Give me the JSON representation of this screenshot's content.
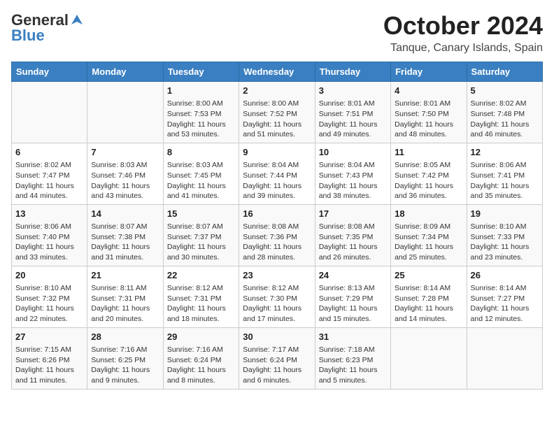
{
  "header": {
    "logo_general": "General",
    "logo_blue": "Blue",
    "month": "October 2024",
    "location": "Tanque, Canary Islands, Spain"
  },
  "days_of_week": [
    "Sunday",
    "Monday",
    "Tuesday",
    "Wednesday",
    "Thursday",
    "Friday",
    "Saturday"
  ],
  "weeks": [
    [
      {
        "day": "",
        "text": ""
      },
      {
        "day": "",
        "text": ""
      },
      {
        "day": "1",
        "text": "Sunrise: 8:00 AM\nSunset: 7:53 PM\nDaylight: 11 hours and 53 minutes."
      },
      {
        "day": "2",
        "text": "Sunrise: 8:00 AM\nSunset: 7:52 PM\nDaylight: 11 hours and 51 minutes."
      },
      {
        "day": "3",
        "text": "Sunrise: 8:01 AM\nSunset: 7:51 PM\nDaylight: 11 hours and 49 minutes."
      },
      {
        "day": "4",
        "text": "Sunrise: 8:01 AM\nSunset: 7:50 PM\nDaylight: 11 hours and 48 minutes."
      },
      {
        "day": "5",
        "text": "Sunrise: 8:02 AM\nSunset: 7:48 PM\nDaylight: 11 hours and 46 minutes."
      }
    ],
    [
      {
        "day": "6",
        "text": "Sunrise: 8:02 AM\nSunset: 7:47 PM\nDaylight: 11 hours and 44 minutes."
      },
      {
        "day": "7",
        "text": "Sunrise: 8:03 AM\nSunset: 7:46 PM\nDaylight: 11 hours and 43 minutes."
      },
      {
        "day": "8",
        "text": "Sunrise: 8:03 AM\nSunset: 7:45 PM\nDaylight: 11 hours and 41 minutes."
      },
      {
        "day": "9",
        "text": "Sunrise: 8:04 AM\nSunset: 7:44 PM\nDaylight: 11 hours and 39 minutes."
      },
      {
        "day": "10",
        "text": "Sunrise: 8:04 AM\nSunset: 7:43 PM\nDaylight: 11 hours and 38 minutes."
      },
      {
        "day": "11",
        "text": "Sunrise: 8:05 AM\nSunset: 7:42 PM\nDaylight: 11 hours and 36 minutes."
      },
      {
        "day": "12",
        "text": "Sunrise: 8:06 AM\nSunset: 7:41 PM\nDaylight: 11 hours and 35 minutes."
      }
    ],
    [
      {
        "day": "13",
        "text": "Sunrise: 8:06 AM\nSunset: 7:40 PM\nDaylight: 11 hours and 33 minutes."
      },
      {
        "day": "14",
        "text": "Sunrise: 8:07 AM\nSunset: 7:38 PM\nDaylight: 11 hours and 31 minutes."
      },
      {
        "day": "15",
        "text": "Sunrise: 8:07 AM\nSunset: 7:37 PM\nDaylight: 11 hours and 30 minutes."
      },
      {
        "day": "16",
        "text": "Sunrise: 8:08 AM\nSunset: 7:36 PM\nDaylight: 11 hours and 28 minutes."
      },
      {
        "day": "17",
        "text": "Sunrise: 8:08 AM\nSunset: 7:35 PM\nDaylight: 11 hours and 26 minutes."
      },
      {
        "day": "18",
        "text": "Sunrise: 8:09 AM\nSunset: 7:34 PM\nDaylight: 11 hours and 25 minutes."
      },
      {
        "day": "19",
        "text": "Sunrise: 8:10 AM\nSunset: 7:33 PM\nDaylight: 11 hours and 23 minutes."
      }
    ],
    [
      {
        "day": "20",
        "text": "Sunrise: 8:10 AM\nSunset: 7:32 PM\nDaylight: 11 hours and 22 minutes."
      },
      {
        "day": "21",
        "text": "Sunrise: 8:11 AM\nSunset: 7:31 PM\nDaylight: 11 hours and 20 minutes."
      },
      {
        "day": "22",
        "text": "Sunrise: 8:12 AM\nSunset: 7:31 PM\nDaylight: 11 hours and 18 minutes."
      },
      {
        "day": "23",
        "text": "Sunrise: 8:12 AM\nSunset: 7:30 PM\nDaylight: 11 hours and 17 minutes."
      },
      {
        "day": "24",
        "text": "Sunrise: 8:13 AM\nSunset: 7:29 PM\nDaylight: 11 hours and 15 minutes."
      },
      {
        "day": "25",
        "text": "Sunrise: 8:14 AM\nSunset: 7:28 PM\nDaylight: 11 hours and 14 minutes."
      },
      {
        "day": "26",
        "text": "Sunrise: 8:14 AM\nSunset: 7:27 PM\nDaylight: 11 hours and 12 minutes."
      }
    ],
    [
      {
        "day": "27",
        "text": "Sunrise: 7:15 AM\nSunset: 6:26 PM\nDaylight: 11 hours and 11 minutes."
      },
      {
        "day": "28",
        "text": "Sunrise: 7:16 AM\nSunset: 6:25 PM\nDaylight: 11 hours and 9 minutes."
      },
      {
        "day": "29",
        "text": "Sunrise: 7:16 AM\nSunset: 6:24 PM\nDaylight: 11 hours and 8 minutes."
      },
      {
        "day": "30",
        "text": "Sunrise: 7:17 AM\nSunset: 6:24 PM\nDaylight: 11 hours and 6 minutes."
      },
      {
        "day": "31",
        "text": "Sunrise: 7:18 AM\nSunset: 6:23 PM\nDaylight: 11 hours and 5 minutes."
      },
      {
        "day": "",
        "text": ""
      },
      {
        "day": "",
        "text": ""
      }
    ]
  ]
}
